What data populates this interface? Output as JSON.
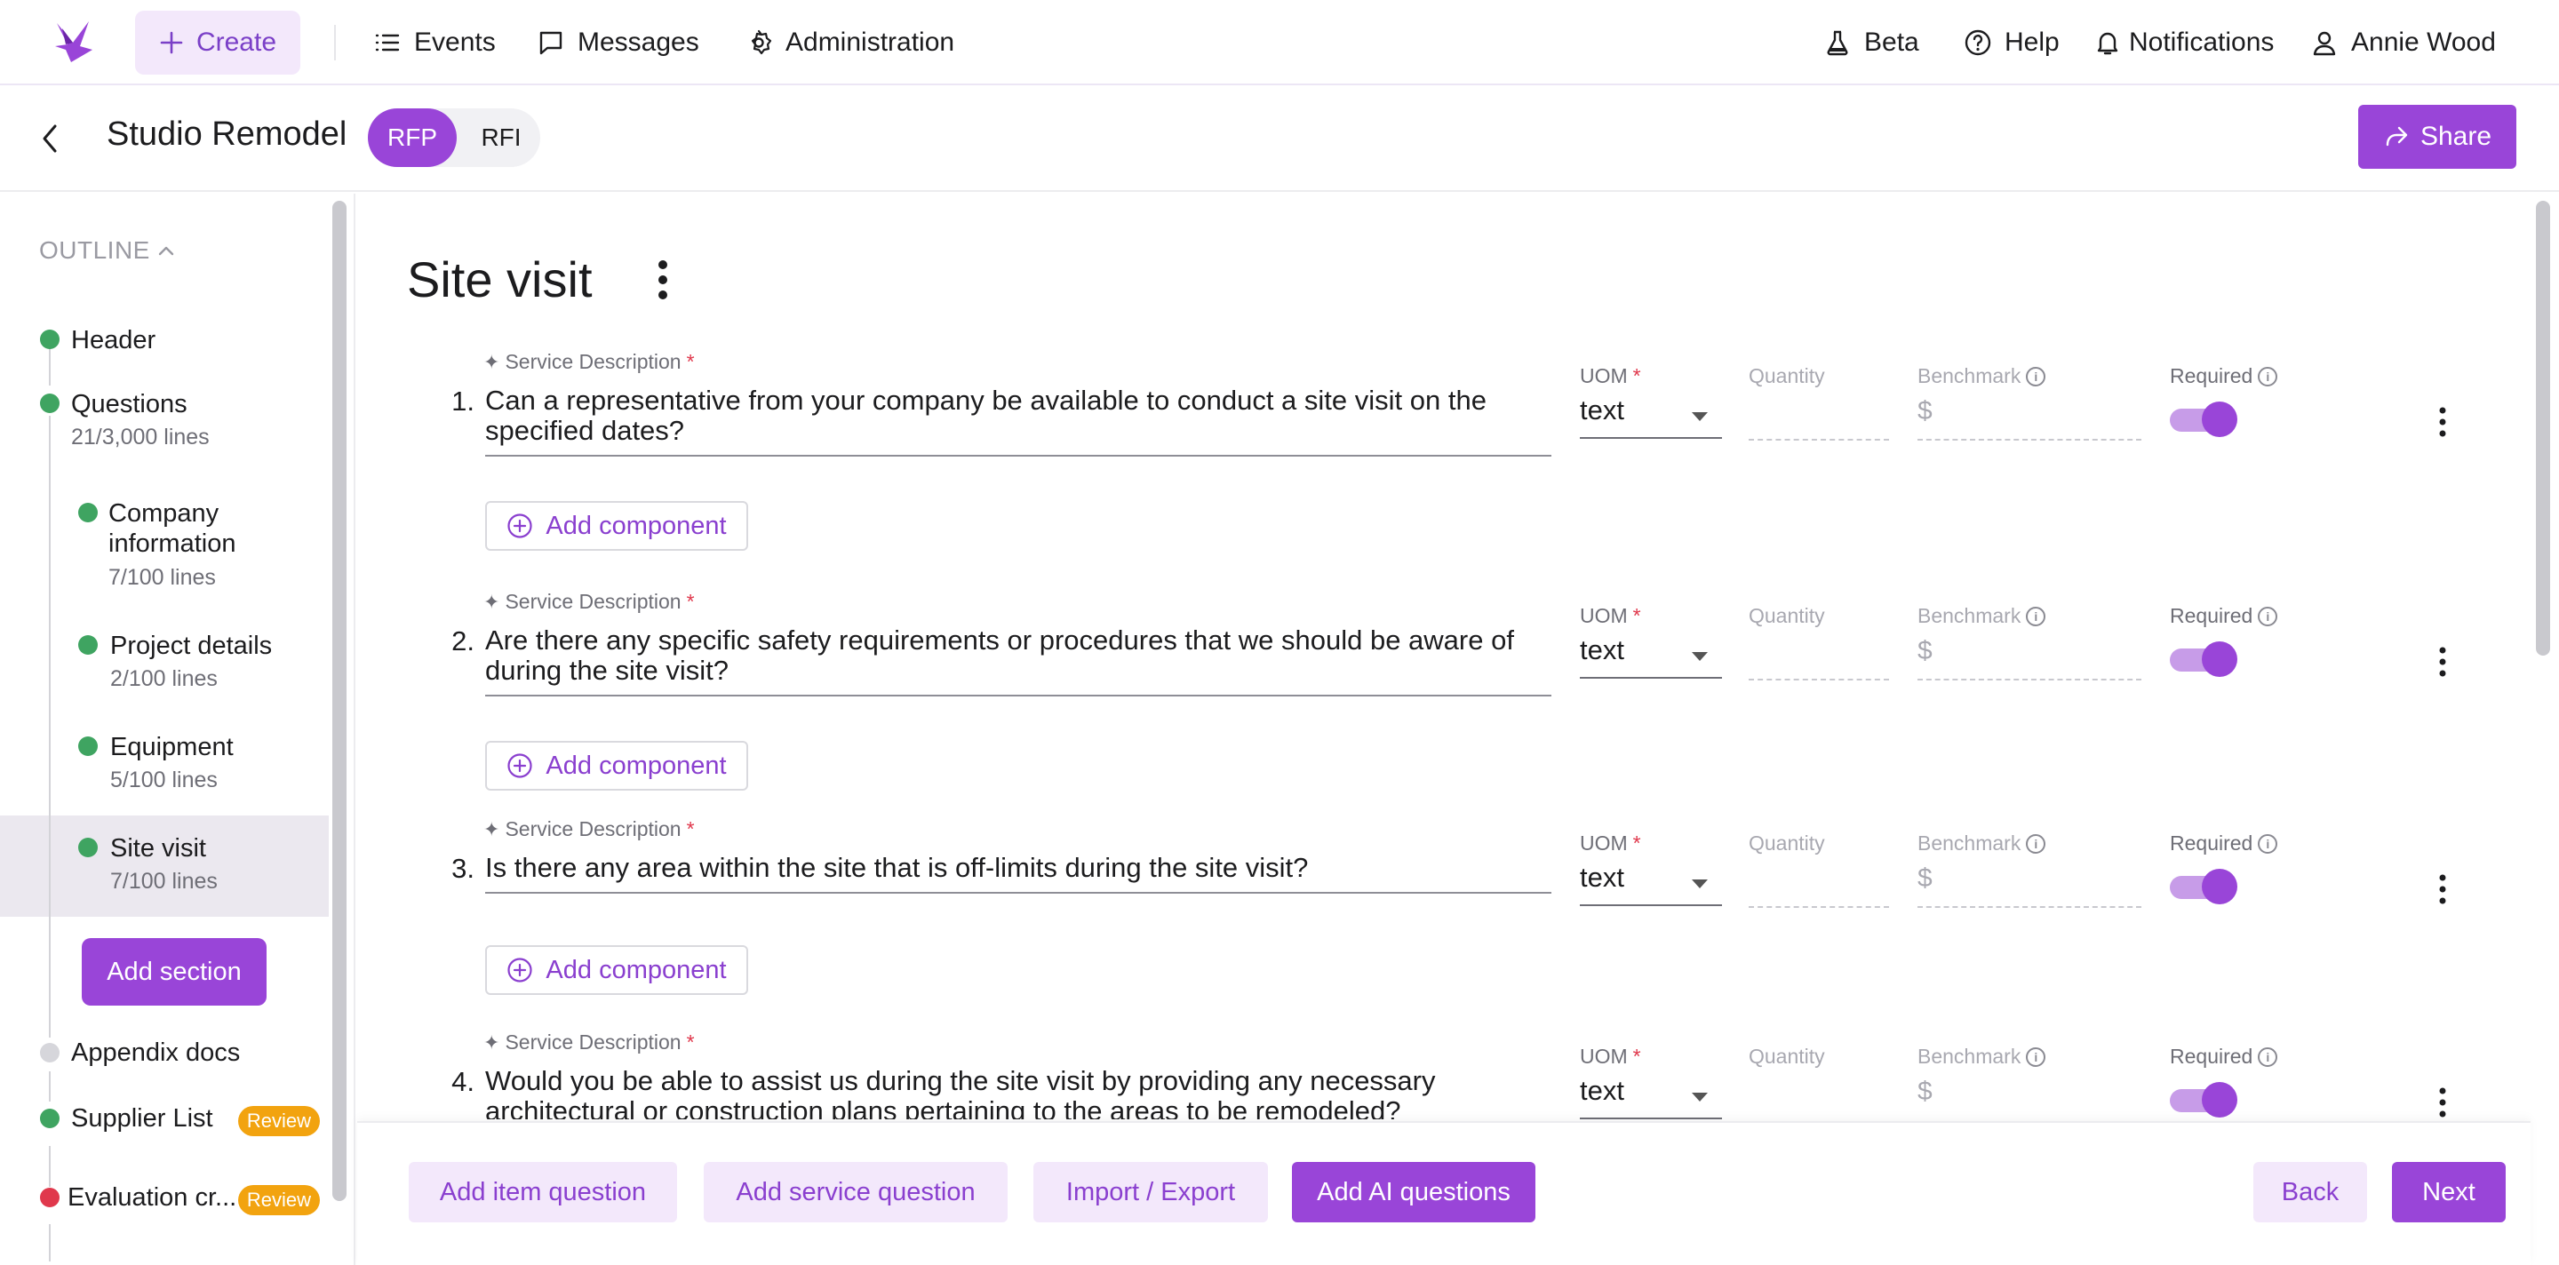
{
  "nav": {
    "create": "Create",
    "events": "Events",
    "messages": "Messages",
    "administration": "Administration",
    "beta": "Beta",
    "help": "Help",
    "notifications": "Notifications",
    "user": "Annie Wood"
  },
  "header": {
    "title": "Studio Remodel",
    "tabs": [
      "RFP",
      "RFI"
    ],
    "active_tab": "RFP",
    "share": "Share"
  },
  "sidebar": {
    "outline_label": "OUTLINE",
    "items": [
      {
        "label": "Header",
        "status": "complete"
      },
      {
        "label": "Questions",
        "sub": "21/3,000 lines",
        "status": "complete"
      },
      {
        "label": "Company information",
        "sub": "7/100 lines",
        "status": "complete"
      },
      {
        "label": "Project details",
        "sub": "2/100 lines",
        "status": "complete"
      },
      {
        "label": "Equipment",
        "sub": "5/100 lines",
        "status": "complete"
      },
      {
        "label": "Site visit",
        "sub": "7/100 lines",
        "status": "complete",
        "active": true
      },
      {
        "label": "Appendix docs",
        "status": "empty"
      },
      {
        "label": "Supplier List",
        "status": "complete",
        "badge": "Review"
      },
      {
        "label": "Evaluation cr...",
        "status": "error",
        "badge": "Review"
      }
    ],
    "add_section": "Add section"
  },
  "main": {
    "section_title": "Site visit",
    "labels": {
      "service_description": "Service Description",
      "uom": "UOM",
      "quantity": "Quantity",
      "benchmark": "Benchmark",
      "required": "Required",
      "currency": "$",
      "add_component": "Add component"
    },
    "questions": [
      {
        "num": "1.",
        "text": "Can a representative from your company be available to conduct a site visit on the specified dates?",
        "uom": "text",
        "required": true
      },
      {
        "num": "2.",
        "text": "Are there any specific safety requirements or procedures that we should be aware of during the site visit?",
        "uom": "text",
        "required": true
      },
      {
        "num": "3.",
        "text": "Is there any area within the site that is off-limits during the site visit?",
        "uom": "text",
        "required": true
      },
      {
        "num": "4.",
        "text": "Would you be able to assist us during the site visit by providing any necessary architectural or construction plans pertaining to the areas to be remodeled?",
        "uom": "text",
        "required": true
      }
    ]
  },
  "footer": {
    "add_item_question": "Add item question",
    "add_service_question": "Add service question",
    "import_export": "Import / Export",
    "add_ai_questions": "Add AI questions",
    "back": "Back",
    "next": "Next"
  },
  "colors": {
    "accent": "#9945d8",
    "accent_light": "#f3e8fb",
    "success": "#3fa461",
    "warning": "#f2a30f",
    "error": "#e0384c"
  }
}
